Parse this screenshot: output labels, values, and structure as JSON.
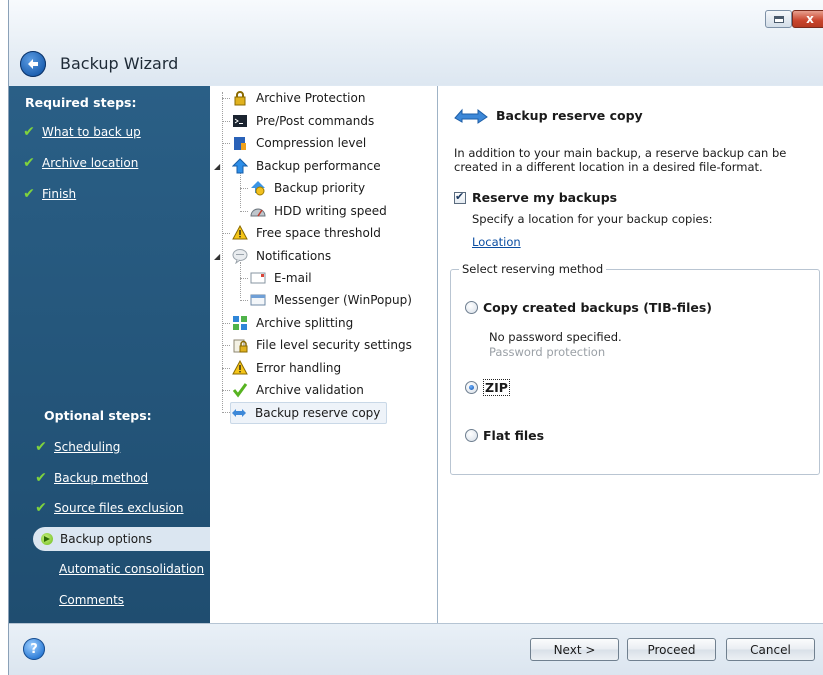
{
  "window": {
    "title": "Backup Wizard",
    "close_glyph": "x"
  },
  "steps": {
    "required_heading": "Required steps:",
    "required": [
      {
        "label": "What to back up"
      },
      {
        "label": "Archive location"
      },
      {
        "label": "Finish"
      }
    ],
    "optional_heading": "Optional steps:",
    "optional": [
      {
        "label": "Scheduling"
      },
      {
        "label": "Backup method"
      },
      {
        "label": "Source files exclusion"
      },
      {
        "label": "Backup options"
      },
      {
        "label": "Automatic consolidation"
      },
      {
        "label": "Comments"
      }
    ]
  },
  "tree": [
    {
      "label": "Archive Protection",
      "icon": "lock-icon"
    },
    {
      "label": "Pre/Post commands",
      "icon": "console-icon"
    },
    {
      "label": "Compression level",
      "icon": "compression-icon"
    },
    {
      "label": "Backup performance",
      "icon": "up-arrow-icon"
    },
    {
      "label": "Backup priority",
      "icon": "priority-icon"
    },
    {
      "label": "HDD writing speed",
      "icon": "speedometer-icon"
    },
    {
      "label": "Free space threshold",
      "icon": "warning-icon"
    },
    {
      "label": "Notifications",
      "icon": "notification-icon"
    },
    {
      "label": "E-mail",
      "icon": "email-icon"
    },
    {
      "label": "Messenger (WinPopup)",
      "icon": "messenger-icon"
    },
    {
      "label": "Archive splitting",
      "icon": "splitting-icon"
    },
    {
      "label": "File level security settings",
      "icon": "security-icon"
    },
    {
      "label": "Error handling",
      "icon": "warning-icon"
    },
    {
      "label": "Archive validation",
      "icon": "check-icon"
    },
    {
      "label": "Backup reserve copy",
      "icon": "reserve-copy-icon"
    }
  ],
  "content": {
    "title": "Backup reserve copy",
    "description": "In addition to your main backup, a reserve backup can be created in a different location in a desired file-format.",
    "reserve_checkbox": "Reserve my backups",
    "reserve_checked": true,
    "specify_text": "Specify a location for your backup copies:",
    "location_link": "Location",
    "group_label": "Select reserving method",
    "options": [
      {
        "label": "Copy created backups (TIB-files)",
        "selected": false
      },
      {
        "label": "ZIP",
        "selected": true
      },
      {
        "label": "Flat files",
        "selected": false
      }
    ],
    "no_password": "No password specified.",
    "password_protection": "Password protection"
  },
  "footer": {
    "help": "?",
    "next": "Next >",
    "proceed": "Proceed",
    "cancel": "Cancel"
  }
}
